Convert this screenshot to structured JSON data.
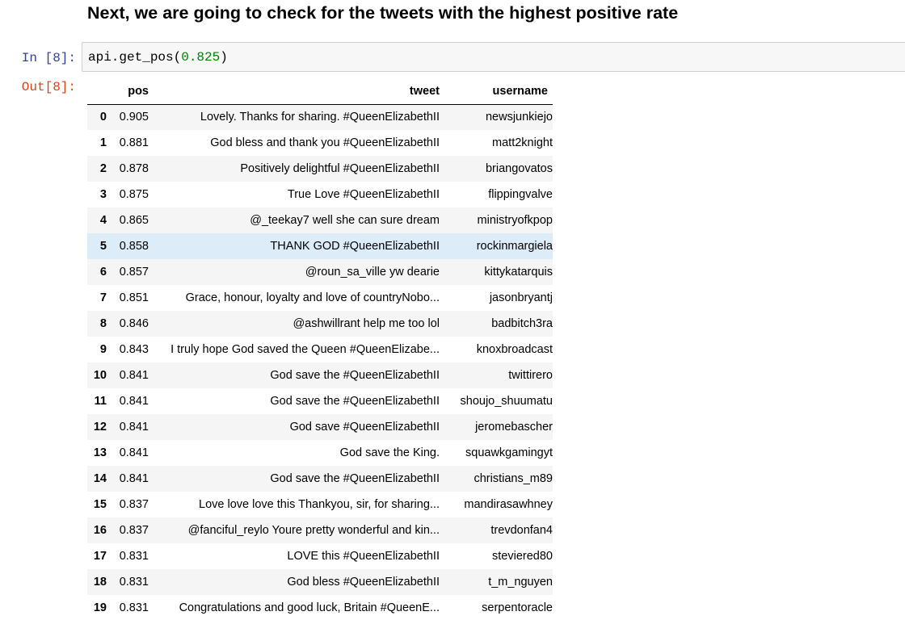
{
  "heading": "Next, we are going to check for the tweets with the highest positive rate",
  "cell": {
    "in_prompt": "In [8]:",
    "out_prompt": "Out[8]:",
    "code_func": "api.get_pos(",
    "code_arg": "0.825",
    "code_close": ")"
  },
  "table": {
    "columns": [
      "pos",
      "tweet",
      "username"
    ],
    "rows": [
      {
        "idx": "0",
        "pos": "0.905",
        "tweet": "Lovely. Thanks for sharing. #QueenElizabethII",
        "username": "newsjunkiejo"
      },
      {
        "idx": "1",
        "pos": "0.881",
        "tweet": "God bless and thank you #QueenElizabethII",
        "username": "matt2knight"
      },
      {
        "idx": "2",
        "pos": "0.878",
        "tweet": "Positively delightful #QueenElizabethII",
        "username": "briangovatos"
      },
      {
        "idx": "3",
        "pos": "0.875",
        "tweet": "True Love #QueenElizabethII",
        "username": "flippingvalve"
      },
      {
        "idx": "4",
        "pos": "0.865",
        "tweet": "@_teekay7 well she can sure dream",
        "username": "ministryofkpop"
      },
      {
        "idx": "5",
        "pos": "0.858",
        "tweet": "THANK GOD #QueenElizabethII",
        "username": "rockinmargiela"
      },
      {
        "idx": "6",
        "pos": "0.857",
        "tweet": "@roun_sa_ville yw dearie",
        "username": "kittykatarquis"
      },
      {
        "idx": "7",
        "pos": "0.851",
        "tweet": "Grace, honour, loyalty and love of countryNobo...",
        "username": "jasonbryantj"
      },
      {
        "idx": "8",
        "pos": "0.846",
        "tweet": "@ashwillrant help me too lol",
        "username": "badbitch3ra"
      },
      {
        "idx": "9",
        "pos": "0.843",
        "tweet": "I truly hope God saved the Queen #QueenElizabe...",
        "username": "knoxbroadcast"
      },
      {
        "idx": "10",
        "pos": "0.841",
        "tweet": "God save the #QueenElizabethII",
        "username": "twittirero"
      },
      {
        "idx": "11",
        "pos": "0.841",
        "tweet": "God save the #QueenElizabethII",
        "username": "shoujo_shuumatu"
      },
      {
        "idx": "12",
        "pos": "0.841",
        "tweet": "God save #QueenElizabethII",
        "username": "jeromebascher"
      },
      {
        "idx": "13",
        "pos": "0.841",
        "tweet": "God save the King.",
        "username": "squawkgamingyt"
      },
      {
        "idx": "14",
        "pos": "0.841",
        "tweet": "God save the #QueenElizabethII",
        "username": "christians_m89"
      },
      {
        "idx": "15",
        "pos": "0.837",
        "tweet": "Love love love this Thankyou, sir, for sharing...",
        "username": "mandirasawhney"
      },
      {
        "idx": "16",
        "pos": "0.837",
        "tweet": "@fanciful_reylo Youre pretty wonderful and kin...",
        "username": "trevdonfan4"
      },
      {
        "idx": "17",
        "pos": "0.831",
        "tweet": "LOVE this #QueenElizabethII",
        "username": "steviered80"
      },
      {
        "idx": "18",
        "pos": "0.831",
        "tweet": "God bless #QueenElizabethII",
        "username": "t_m_nguyen"
      },
      {
        "idx": "19",
        "pos": "0.831",
        "tweet": "Congratulations and good luck, Britain #QueenE...",
        "username": "serpentoracle"
      }
    ],
    "hover_row": "5"
  },
  "colors": {
    "in_prompt": "#303f9f",
    "out_prompt": "#d84315",
    "code_number": "#008000",
    "row_stripe": "#f5f5f5",
    "row_hover": "#dcecf9"
  }
}
